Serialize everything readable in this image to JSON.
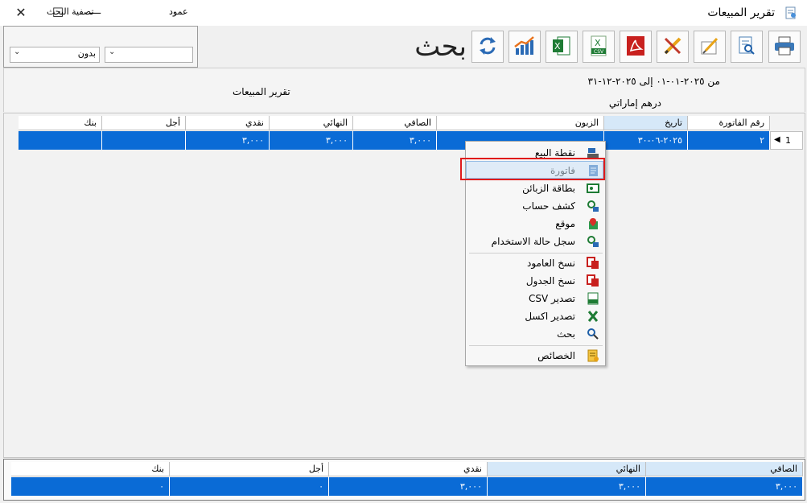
{
  "window": {
    "title": "تقرير المبيعات",
    "close_glyph": "✕",
    "maximize_glyph": "☐",
    "minimize_glyph": "—"
  },
  "toolbar": {
    "search_word": "بحث",
    "buttons": [
      "print-icon",
      "preview-icon",
      "edit-report-icon",
      "design-icon",
      "pdf-icon",
      "csv-icon",
      "excel-icon",
      "chart-icon",
      "refresh-icon"
    ]
  },
  "filter": {
    "column_label": "عمود",
    "column_value": "",
    "filter_label": "تصفية البحث",
    "filter_value": "بدون"
  },
  "report": {
    "date_range": "من ٢٠٢٥-٠١-٠١ إلى ٢٠٢٥-١٢-٣١",
    "currency": "درهم إماراتي",
    "title": "تقرير المبيعات"
  },
  "grid": {
    "columns": [
      "رقم الفاتورة",
      "تاريخ",
      "الزبون",
      "الصافي",
      "النهائي",
      "نقدي",
      "أجل",
      "بنك"
    ],
    "row": {
      "index": "1",
      "invoice": "٢",
      "date": "٢٠٢٥-٠٦-٣٠",
      "customer": "",
      "net": "٣,٠٠٠",
      "final": "٣,٠٠٠",
      "cash": "٣,٠٠٠",
      "credit": "",
      "bank": ""
    }
  },
  "context_menu": {
    "items": [
      {
        "label": "نقطة البيع",
        "icon": "pos-icon"
      },
      {
        "label": "فاتورة",
        "icon": "invoice-icon"
      },
      {
        "label": "بطاقة الزبائن",
        "icon": "customer-card-icon"
      },
      {
        "label": "كشف حساب",
        "icon": "statement-icon"
      },
      {
        "label": "موقع",
        "icon": "location-icon"
      },
      {
        "label": "سجل حالة الاستخدام",
        "icon": "usage-log-icon"
      },
      {
        "label": "نسخ العامود",
        "icon": "copy-column-icon"
      },
      {
        "label": "نسخ الجدول",
        "icon": "copy-table-icon"
      },
      {
        "label": "تصدير CSV",
        "icon": "csv-export-icon"
      },
      {
        "label": "تصدير اكسل",
        "icon": "excel-export-icon"
      },
      {
        "label": "بحث",
        "icon": "search-icon"
      },
      {
        "label": "الخصائص",
        "icon": "properties-icon"
      }
    ],
    "highlighted": "فاتورة"
  },
  "footer": {
    "columns": [
      "الصافي",
      "النهائي",
      "نقدي",
      "أجل",
      "بنك"
    ],
    "values": [
      "٣,٠٠٠",
      "٣,٠٠٠",
      "٣,٠٠٠",
      "٠",
      "٠"
    ]
  },
  "colors": {
    "selection": "#0a6bd6",
    "highlight_box": "#e01b1b"
  }
}
